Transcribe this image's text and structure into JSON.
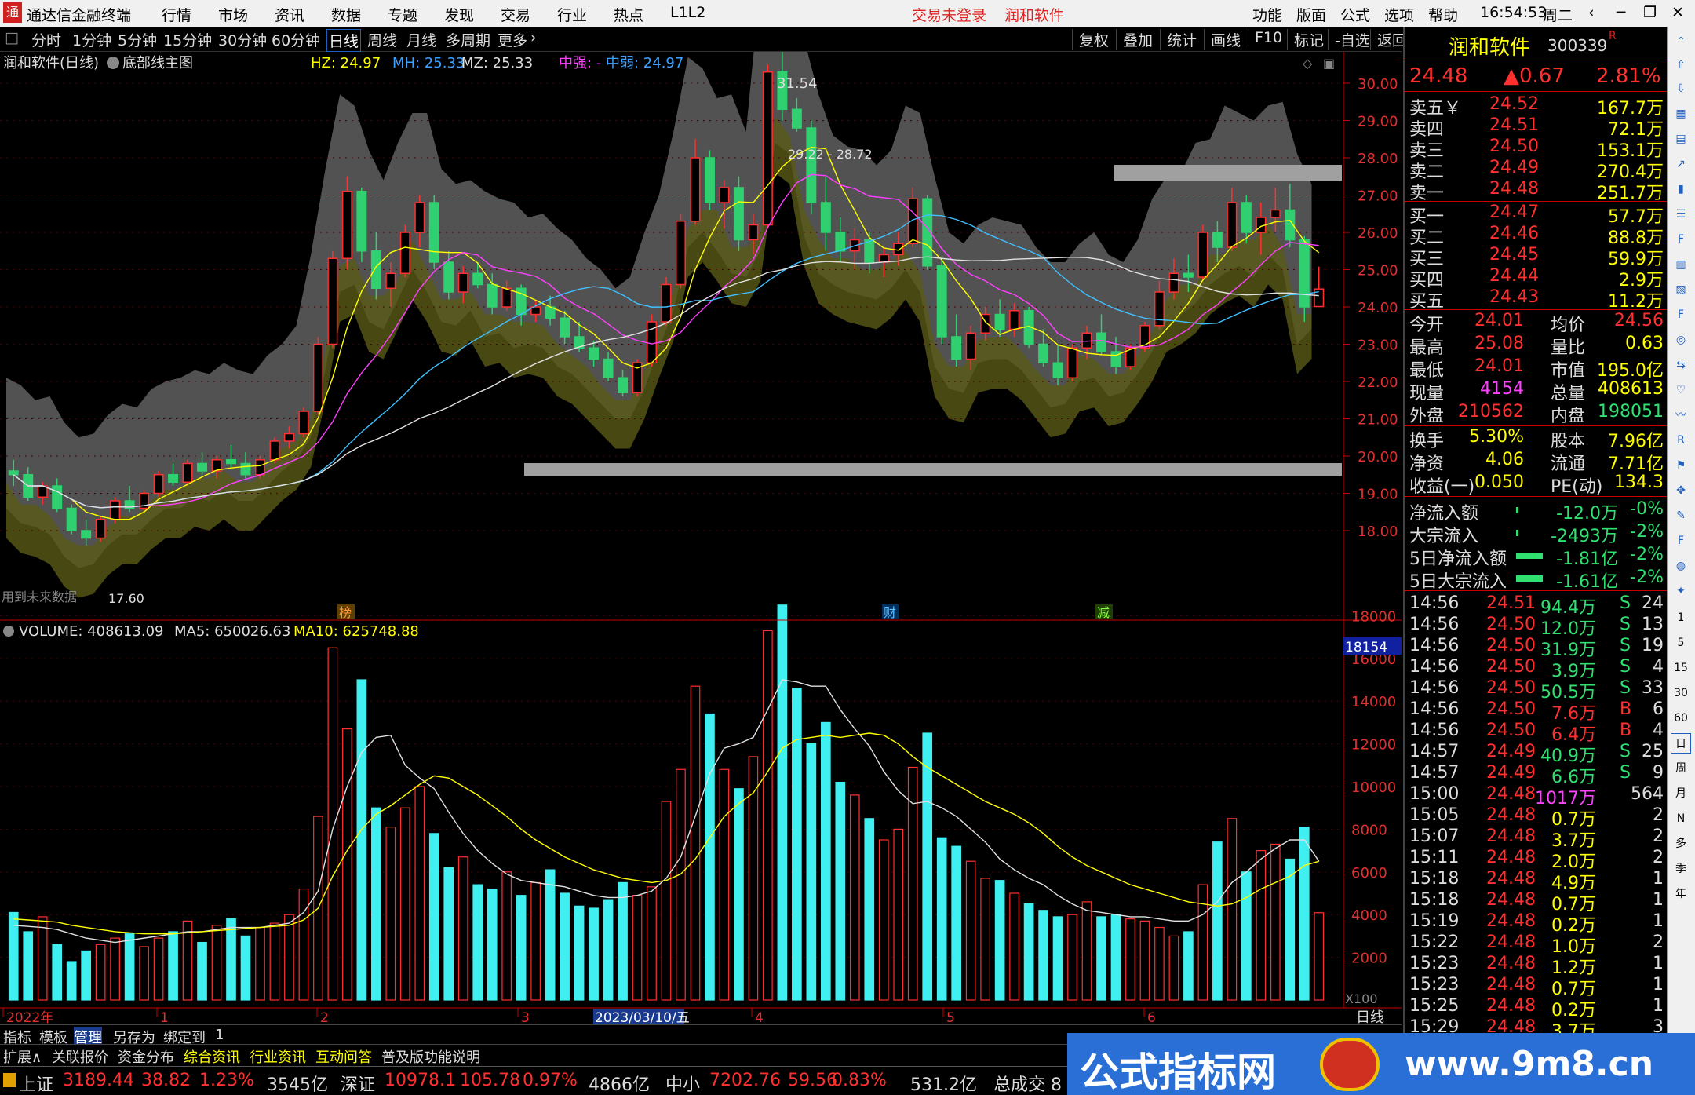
{
  "app": {
    "title": "通达信金融终端",
    "menus": [
      "行情",
      "市场",
      "资讯",
      "数据",
      "专题",
      "发现",
      "交易",
      "行业",
      "热点",
      "L1L2"
    ],
    "login": "交易未登录",
    "brand": "润和软件",
    "right_menus": [
      "功能",
      "版面",
      "公式",
      "选项",
      "帮助"
    ],
    "time": "16:54:53",
    "weekday": "周二"
  },
  "periods": [
    "分时",
    "1分钟",
    "5分钟",
    "15分钟",
    "30分钟",
    "60分钟",
    "日线",
    "周线",
    "月线",
    "多周期",
    "更多"
  ],
  "active_period": "日线",
  "tools": [
    "复权",
    "叠加",
    "统计",
    "画线",
    "F10",
    "标记",
    "-自选",
    "返回"
  ],
  "main": {
    "title": "润和软件(日线)",
    "indicator": "底部线主图",
    "hz": "HZ: 24.97",
    "mh": "MH: 25.33",
    "mz": "MZ: 25.33",
    "zq": "中强: -",
    "zr": "中弱: 24.97",
    "high_label": "31.54",
    "range_label": "29.22 - 28.72",
    "low_label": "17.60",
    "future_note": "用到未来数据",
    "marks": [
      "榜",
      "财",
      "减"
    ]
  },
  "axis": {
    "price_ticks": [
      "30.00",
      "29.00",
      "28.00",
      "27.00",
      "26.00",
      "25.00",
      "24.00",
      "23.00",
      "22.00",
      "21.00",
      "20.00",
      "19.00",
      "18.00"
    ],
    "vol_ticks": [
      "18000",
      "16000",
      "14000",
      "12000",
      "10000",
      "8000",
      "6000",
      "4000",
      "2000"
    ],
    "vol_box": "18154",
    "vol_unit": "X100",
    "dates": [
      "2022年",
      "1",
      "2",
      "3",
      "4",
      "5",
      "6"
    ],
    "cursor_date": "2023/03/10/五",
    "period_label": "日线"
  },
  "volume": {
    "label": "VOLUME: 408613.09",
    "ma5": "MA5: 650026.63",
    "ma10": "MA10: 625748.88"
  },
  "chart_data": {
    "type": "candlestick",
    "price_range": [
      17.6,
      31.54
    ],
    "candles": [
      [
        19.6,
        19.9,
        19.2,
        19.5
      ],
      [
        19.5,
        19.7,
        18.8,
        18.9
      ],
      [
        18.9,
        19.3,
        18.7,
        19.2
      ],
      [
        19.2,
        19.4,
        18.5,
        18.6
      ],
      [
        18.6,
        18.7,
        17.9,
        18.0
      ],
      [
        18.0,
        18.3,
        17.6,
        17.8
      ],
      [
        17.8,
        18.4,
        17.7,
        18.3
      ],
      [
        18.3,
        18.9,
        18.2,
        18.8
      ],
      [
        18.8,
        19.2,
        18.5,
        18.6
      ],
      [
        18.6,
        19.1,
        18.5,
        19.0
      ],
      [
        19.0,
        19.6,
        18.9,
        19.5
      ],
      [
        19.5,
        19.8,
        19.2,
        19.3
      ],
      [
        19.3,
        19.9,
        19.2,
        19.8
      ],
      [
        19.8,
        20.1,
        19.5,
        19.6
      ],
      [
        19.6,
        20.0,
        19.4,
        19.9
      ],
      [
        19.9,
        20.3,
        19.7,
        19.8
      ],
      [
        19.8,
        20.1,
        19.4,
        19.5
      ],
      [
        19.5,
        20.0,
        19.4,
        19.9
      ],
      [
        19.9,
        20.5,
        19.8,
        20.4
      ],
      [
        20.4,
        20.8,
        20.2,
        20.6
      ],
      [
        20.6,
        21.3,
        20.5,
        21.2
      ],
      [
        21.2,
        23.2,
        21.1,
        23.0
      ],
      [
        23.0,
        25.5,
        22.9,
        25.3
      ],
      [
        25.3,
        27.5,
        25.0,
        27.1
      ],
      [
        27.1,
        27.2,
        25.2,
        25.5
      ],
      [
        25.5,
        26.0,
        24.2,
        24.5
      ],
      [
        24.5,
        25.2,
        24.0,
        24.9
      ],
      [
        24.9,
        26.2,
        24.8,
        26.0
      ],
      [
        26.0,
        27.0,
        25.6,
        26.8
      ],
      [
        26.8,
        27.0,
        25.0,
        25.2
      ],
      [
        25.2,
        25.5,
        24.2,
        24.4
      ],
      [
        24.4,
        25.1,
        24.1,
        24.9
      ],
      [
        24.9,
        25.2,
        24.5,
        24.6
      ],
      [
        24.6,
        24.9,
        23.8,
        24.0
      ],
      [
        24.0,
        24.7,
        23.9,
        24.5
      ],
      [
        24.5,
        24.6,
        23.5,
        23.8
      ],
      [
        23.8,
        24.2,
        23.6,
        24.0
      ],
      [
        24.0,
        24.3,
        23.5,
        23.7
      ],
      [
        23.7,
        23.9,
        23.0,
        23.2
      ],
      [
        23.2,
        23.6,
        22.8,
        22.9
      ],
      [
        22.9,
        23.1,
        22.4,
        22.6
      ],
      [
        22.6,
        22.8,
        22.0,
        22.1
      ],
      [
        22.1,
        22.3,
        21.6,
        21.7
      ],
      [
        21.7,
        22.6,
        21.6,
        22.5
      ],
      [
        22.5,
        23.8,
        22.4,
        23.6
      ],
      [
        23.6,
        24.8,
        23.5,
        24.6
      ],
      [
        24.6,
        26.5,
        24.5,
        26.3
      ],
      [
        26.3,
        28.5,
        26.2,
        28.0
      ],
      [
        28.0,
        28.2,
        26.6,
        26.8
      ],
      [
        26.8,
        27.4,
        26.1,
        27.2
      ],
      [
        27.2,
        27.5,
        25.5,
        25.8
      ],
      [
        25.8,
        26.5,
        25.4,
        26.2
      ],
      [
        26.2,
        30.5,
        26.1,
        30.3
      ],
      [
        30.3,
        31.54,
        29.0,
        29.3
      ],
      [
        29.3,
        29.6,
        28.7,
        28.8
      ],
      [
        28.8,
        29.0,
        26.5,
        26.8
      ],
      [
        26.8,
        27.5,
        25.5,
        26.0
      ],
      [
        26.0,
        26.4,
        25.2,
        25.5
      ],
      [
        25.5,
        26.1,
        25.0,
        25.8
      ],
      [
        25.8,
        26.0,
        24.9,
        25.2
      ],
      [
        25.2,
        25.6,
        24.8,
        25.4
      ],
      [
        25.4,
        26.0,
        25.1,
        25.7
      ],
      [
        25.7,
        27.2,
        25.6,
        26.9
      ],
      [
        26.9,
        27.0,
        25.0,
        25.1
      ],
      [
        25.1,
        25.3,
        23.0,
        23.2
      ],
      [
        23.2,
        23.8,
        22.4,
        22.6
      ],
      [
        22.6,
        23.5,
        22.3,
        23.3
      ],
      [
        23.3,
        24.0,
        23.1,
        23.8
      ],
      [
        23.8,
        24.2,
        23.2,
        23.4
      ],
      [
        23.4,
        24.1,
        23.2,
        23.9
      ],
      [
        23.9,
        24.0,
        22.9,
        23.0
      ],
      [
        23.0,
        23.4,
        22.4,
        22.5
      ],
      [
        22.5,
        23.0,
        21.9,
        22.1
      ],
      [
        22.1,
        23.0,
        22.0,
        22.9
      ],
      [
        22.9,
        23.5,
        22.6,
        23.3
      ],
      [
        23.3,
        23.8,
        22.7,
        22.8
      ],
      [
        22.8,
        23.2,
        22.2,
        22.4
      ],
      [
        22.4,
        23.0,
        22.3,
        22.9
      ],
      [
        22.9,
        23.6,
        22.8,
        23.5
      ],
      [
        23.5,
        24.7,
        23.4,
        24.4
      ],
      [
        24.4,
        25.3,
        24.2,
        24.9
      ],
      [
        24.9,
        25.4,
        24.4,
        24.8
      ],
      [
        24.8,
        26.2,
        24.7,
        26.0
      ],
      [
        26.0,
        26.3,
        25.2,
        25.6
      ],
      [
        25.6,
        27.2,
        25.5,
        26.8
      ],
      [
        26.8,
        27.0,
        25.7,
        26.0
      ],
      [
        26.0,
        26.8,
        25.4,
        26.4
      ],
      [
        26.4,
        27.2,
        26.0,
        26.6
      ],
      [
        26.6,
        27.3,
        25.6,
        25.8
      ],
      [
        25.8,
        25.9,
        23.6,
        24.0
      ],
      [
        24.01,
        25.08,
        24.01,
        24.48
      ]
    ],
    "volume": [
      4100,
      3200,
      3900,
      2600,
      1800,
      2300,
      2600,
      2900,
      3100,
      2500,
      2900,
      3200,
      3700,
      2700,
      3500,
      3800,
      3000,
      3400,
      3600,
      4000,
      5200,
      8600,
      16500,
      12700,
      15000,
      9000,
      8100,
      9000,
      10000,
      7800,
      6200,
      6700,
      5400,
      5200,
      6000,
      4900,
      5500,
      6100,
      5000,
      4400,
      4300,
      4700,
      5500,
      4900,
      5300,
      9300,
      10800,
      14700,
      13400,
      10800,
      9900,
      11400,
      17300,
      18500,
      14600,
      12000,
      13000,
      10200,
      9600,
      8500,
      7500,
      8000,
      10900,
      12500,
      7600,
      7200,
      6500,
      5700,
      5600,
      5000,
      4500,
      4200,
      3900,
      4000,
      4600,
      3900,
      4000,
      3800,
      3700,
      3400,
      3000,
      3200,
      5400,
      7400,
      8500,
      6000,
      7000,
      7300,
      6600,
      8100,
      4090
    ],
    "ma5": [
      3500,
      3450,
      3400,
      3300,
      3100,
      2900,
      2800,
      2700,
      2800,
      2900,
      3000,
      3100,
      3200,
      3200,
      3300,
      3400,
      3400,
      3400,
      3500,
      3600,
      4100,
      5100,
      8000,
      10000,
      11600,
      12300,
      12400,
      11000,
      10400,
      9900,
      8800,
      7800,
      7000,
      6400,
      5900,
      5600,
      5500,
      5400,
      5300,
      5100,
      4900,
      4800,
      4800,
      4900,
      5100,
      5700,
      6700,
      8600,
      10600,
      11800,
      12000,
      12300,
      13600,
      15000,
      14900,
      14700,
      14700,
      13600,
      12700,
      11900,
      10700,
      9800,
      9200,
      9300,
      9000,
      8600,
      8000,
      7400,
      6600,
      6100,
      5700,
      5400,
      4900,
      4500,
      4200,
      4100,
      4000,
      3900,
      3900,
      3800,
      3700,
      3700,
      4000,
      4600,
      5500,
      6000,
      6600,
      7100,
      7500,
      7500,
      6500
    ],
    "ma10": [
      3800,
      3750,
      3700,
      3650,
      3500,
      3400,
      3300,
      3200,
      3150,
      3100,
      3100,
      3100,
      3150,
      3200,
      3250,
      3300,
      3350,
      3400,
      3450,
      3500,
      3750,
      4300,
      5800,
      7000,
      8000,
      8700,
      9100,
      9600,
      10100,
      10500,
      10400,
      10000,
      9600,
      9100,
      8600,
      8000,
      7500,
      7100,
      6700,
      6400,
      6100,
      5900,
      5700,
      5600,
      5500,
      5600,
      5900,
      6600,
      7600,
      8600,
      9200,
      9700,
      10700,
      11800,
      12200,
      12300,
      12400,
      12300,
      12400,
      12500,
      12400,
      12000,
      11400,
      10900,
      10500,
      10100,
      9700,
      9300,
      9000,
      8700,
      8300,
      7800,
      7200,
      6700,
      6300,
      6000,
      5700,
      5400,
      5200,
      5000,
      4800,
      4600,
      4500,
      4400,
      4500,
      4800,
      5200,
      5500,
      5800,
      6300,
      6500
    ]
  },
  "quote": {
    "name": "润和软件",
    "code": "300339",
    "price": "24.48",
    "change": "▲0.67",
    "pct": "2.81%",
    "asks": [
      [
        "卖五￥",
        "24.52",
        "167.7万"
      ],
      [
        "卖四",
        "24.51",
        "72.1万"
      ],
      [
        "卖三",
        "24.50",
        "153.1万"
      ],
      [
        "卖二",
        "24.49",
        "270.4万"
      ],
      [
        "卖一",
        "24.48",
        "251.7万"
      ]
    ],
    "bids": [
      [
        "买一",
        "24.47",
        "57.7万"
      ],
      [
        "买二",
        "24.46",
        "88.8万"
      ],
      [
        "买三",
        "24.45",
        "59.9万"
      ],
      [
        "买四",
        "24.44",
        "2.9万"
      ],
      [
        "买五",
        "24.43",
        "11.2万"
      ]
    ],
    "stats": [
      [
        "今开",
        "24.01",
        "均价",
        "24.56"
      ],
      [
        "最高",
        "25.08",
        "量比",
        "0.63"
      ],
      [
        "最低",
        "24.01",
        "市值",
        "195.0亿"
      ],
      [
        "现量",
        "4154",
        "总量",
        "408613"
      ],
      [
        "外盘",
        "210562",
        "内盘",
        "198051"
      ]
    ],
    "fund": [
      [
        "换手",
        "5.30%",
        "股本",
        "7.96亿"
      ],
      [
        "净资",
        "4.06",
        "流通",
        "7.71亿"
      ],
      [
        "收益(一)",
        "0.050",
        "PE(动)",
        "134.3"
      ]
    ],
    "flow": [
      [
        "净流入额",
        "-12.0万",
        "-0%"
      ],
      [
        "大宗流入",
        "-2493万",
        "-2%"
      ],
      [
        "5日净流入额",
        "-1.81亿",
        "-2%"
      ],
      [
        "5日大宗流入",
        "-1.61亿",
        "-2%"
      ]
    ],
    "ticks": [
      [
        "14:56",
        "24.51",
        "94.4万",
        "S",
        "24"
      ],
      [
        "14:56",
        "24.50",
        "12.0万",
        "S",
        "13"
      ],
      [
        "14:56",
        "24.50",
        "31.9万",
        "S",
        "19"
      ],
      [
        "14:56",
        "24.50",
        "3.9万",
        "S",
        "4"
      ],
      [
        "14:56",
        "24.50",
        "50.5万",
        "S",
        "33"
      ],
      [
        "14:56",
        "24.50",
        "7.6万",
        "B",
        "6"
      ],
      [
        "14:56",
        "24.50",
        "6.4万",
        "B",
        "4"
      ],
      [
        "14:57",
        "24.49",
        "40.9万",
        "S",
        "25"
      ],
      [
        "14:57",
        "24.49",
        "6.6万",
        "S",
        "9"
      ],
      [
        "15:00",
        "24.48",
        "1017万",
        "",
        "564"
      ],
      [
        "15:05",
        "24.48",
        "0.7万",
        "",
        "2"
      ],
      [
        "15:07",
        "24.48",
        "3.7万",
        "",
        "2"
      ],
      [
        "15:11",
        "24.48",
        "2.0万",
        "",
        "2"
      ],
      [
        "15:18",
        "24.48",
        "4.9万",
        "",
        "1"
      ],
      [
        "15:18",
        "24.48",
        "0.7万",
        "",
        "1"
      ],
      [
        "15:19",
        "24.48",
        "0.2万",
        "",
        "1"
      ],
      [
        "15:22",
        "24.48",
        "1.0万",
        "",
        "2"
      ],
      [
        "15:23",
        "24.48",
        "1.2万",
        "",
        "1"
      ],
      [
        "15:23",
        "24.48",
        "0.7万",
        "",
        "1"
      ],
      [
        "15:25",
        "24.48",
        "0.2万",
        "",
        "1"
      ],
      [
        "15:29",
        "24.48",
        "3.7万",
        "",
        "3"
      ]
    ]
  },
  "sidebar_labels": [
    "1",
    "5",
    "15",
    "30",
    "60",
    "日",
    "周",
    "月",
    "N",
    "多",
    "季",
    "年"
  ],
  "bottom": {
    "tabs1": [
      "指标",
      "模板",
      "管理",
      "另存为",
      "绑定到",
      "1"
    ],
    "tabs2": [
      "扩展∧",
      "关联报价",
      "资金分布",
      "综合资讯",
      "行业资讯",
      "互动问答",
      "普及版功能说明"
    ]
  },
  "status": [
    [
      "上证",
      "3189.44",
      "38.82",
      "1.23%",
      "3545亿"
    ],
    [
      "深证",
      "10978.1",
      "105.78",
      "0.97%",
      "4866亿"
    ],
    [
      "中小",
      "7202.76",
      "59.56",
      "0.83%",
      "531.2亿"
    ]
  ],
  "status_tail": "总成交 8",
  "ad": {
    "text": "公式指标网",
    "url": "www.9m8.cn"
  }
}
